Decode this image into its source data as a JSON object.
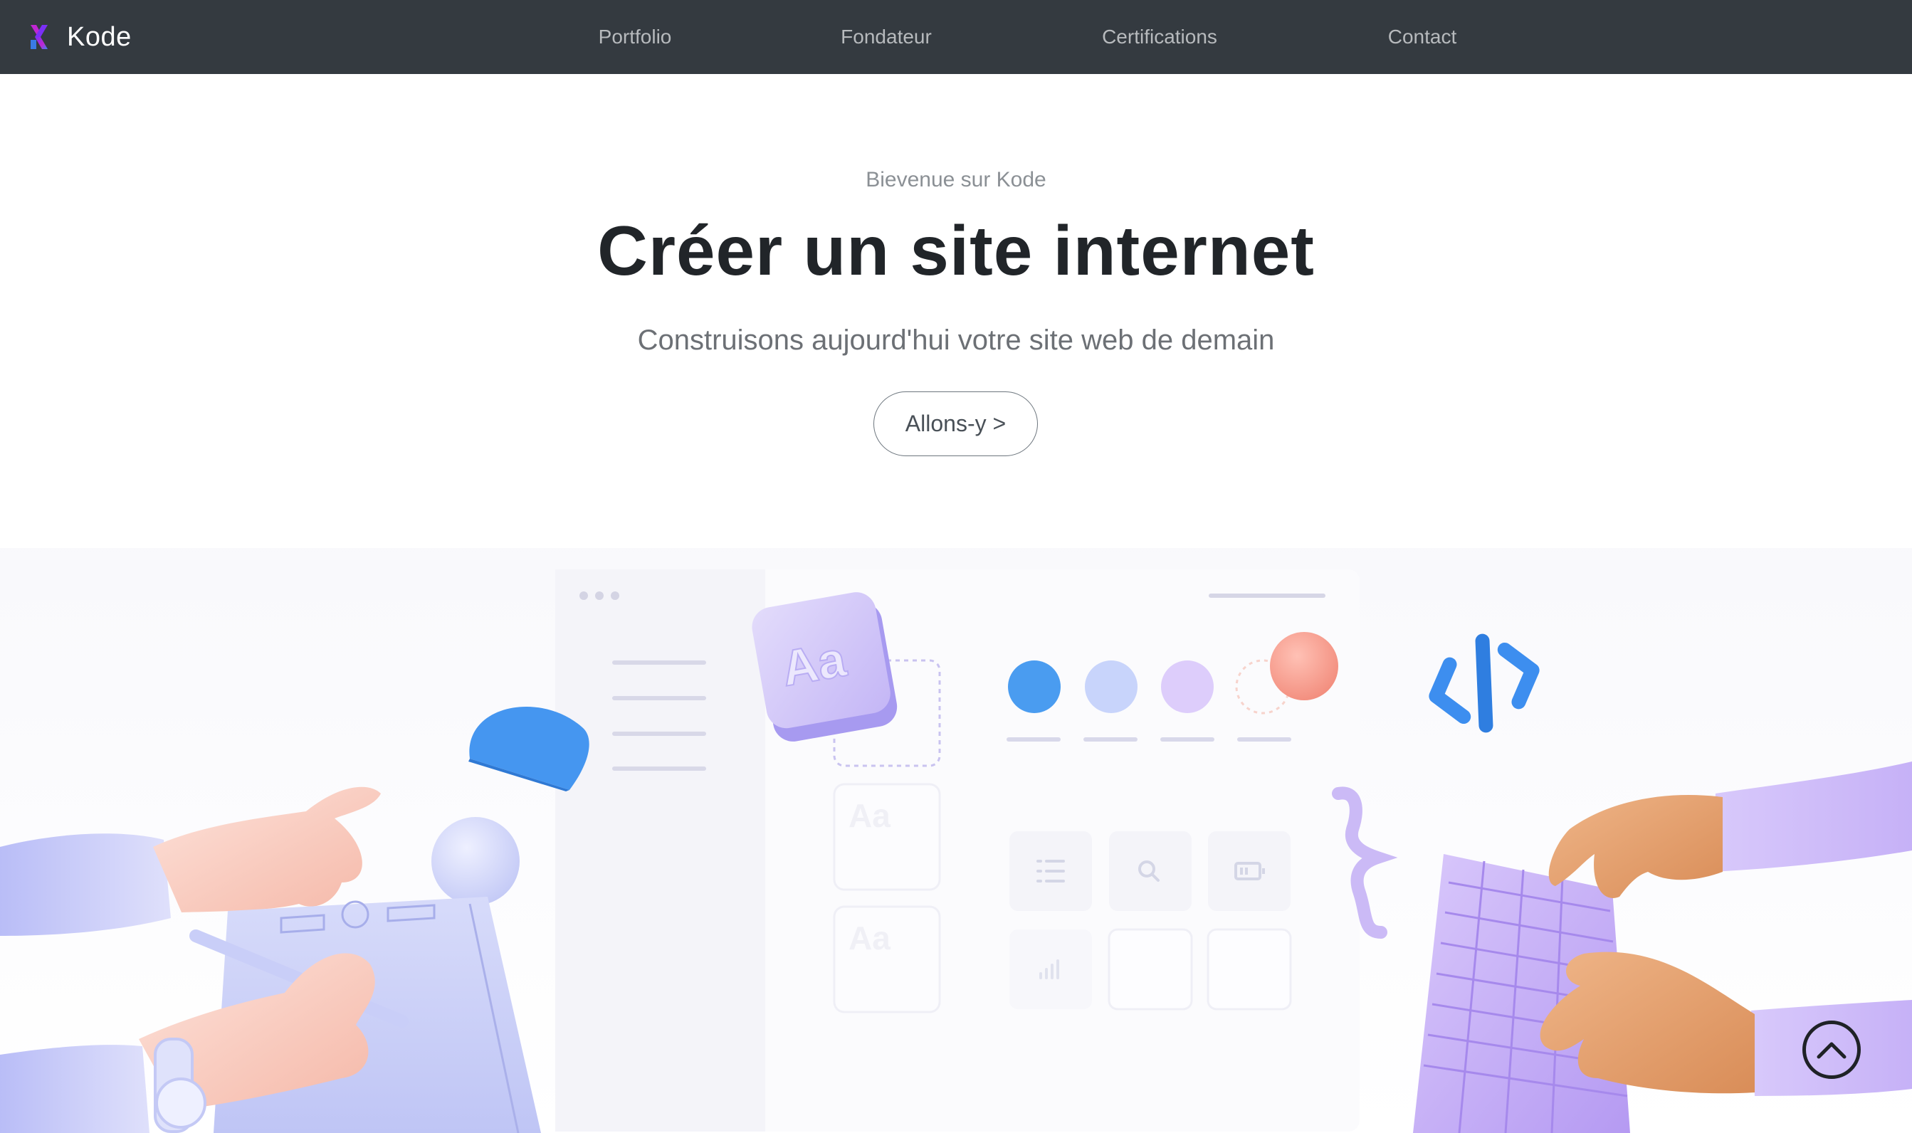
{
  "brand": {
    "name": "Kode",
    "logo_icon": "k-logo-icon",
    "logo_colors": [
      "#7b2ff7",
      "#c026d3",
      "#3b82f6"
    ]
  },
  "nav": {
    "items": [
      {
        "label": "Portfolio"
      },
      {
        "label": "Fondateur"
      },
      {
        "label": "Certifications"
      },
      {
        "label": "Contact"
      }
    ]
  },
  "hero": {
    "eyebrow": "Bievenue sur Kode",
    "title": "Créer un site internet",
    "subtitle": "Construisons aujourd'hui votre site web de demain",
    "cta_label": "Allons-y >"
  },
  "illustration": {
    "font_tile_label": "Aa",
    "ghost_tile_label": "Aa",
    "icons": [
      "list-icon",
      "search-icon",
      "battery-icon",
      "bar-chart-icon",
      "code-brackets-icon",
      "curly-brace-icon"
    ]
  },
  "scroll_top": {
    "icon": "chevron-up-icon"
  },
  "colors": {
    "navbar_bg": "#343a40",
    "nav_link": "#b7babd",
    "title": "#212529",
    "subtitle": "#6c7075",
    "accent_blue": "#3b8ff0",
    "accent_lavender": "#c9b8f5",
    "accent_salmon": "#f59d8f"
  }
}
